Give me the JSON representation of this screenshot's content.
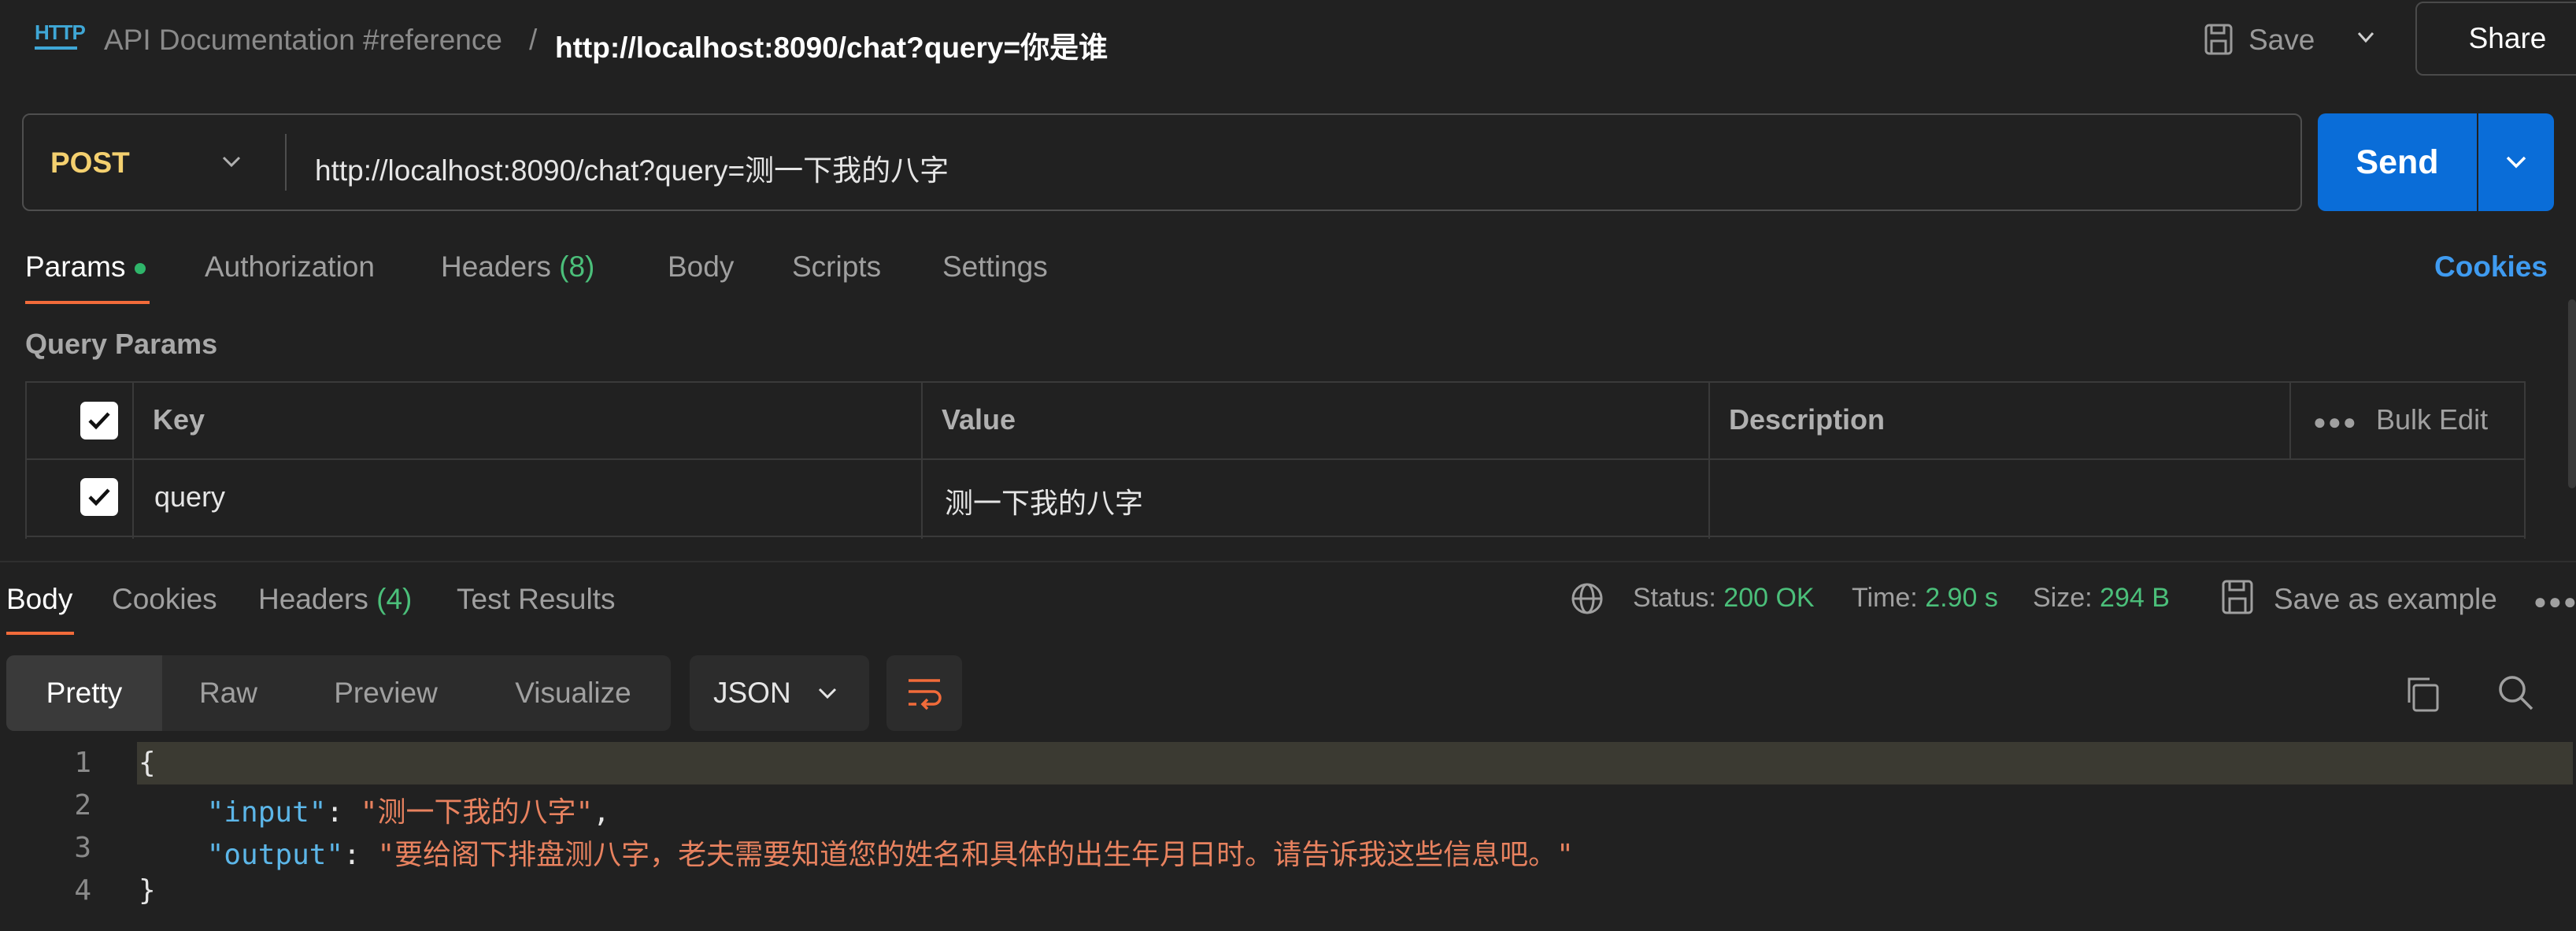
{
  "header": {
    "app_icon_text": "HTTP",
    "breadcrumb_parent": "API Documentation #reference",
    "breadcrumb_sep": "/",
    "title": "http://localhost:8090/chat?query=你是谁",
    "save_label": "Save",
    "share_label": "Share"
  },
  "request": {
    "method": "POST",
    "url": "http://localhost:8090/chat?query=测一下我的八字",
    "send_label": "Send"
  },
  "request_tabs": [
    {
      "label": "Params"
    },
    {
      "label": "Authorization"
    },
    {
      "label": "Headers",
      "count": "(8)"
    },
    {
      "label": "Body"
    },
    {
      "label": "Scripts"
    },
    {
      "label": "Settings"
    }
  ],
  "cookies_label": "Cookies",
  "query_params": {
    "title": "Query Params",
    "columns": {
      "key": "Key",
      "value": "Value",
      "description": "Description"
    },
    "bulk_edit_label": "Bulk Edit",
    "rows": [
      {
        "checked": true,
        "key": "query",
        "value": "测一下我的八字",
        "description": ""
      }
    ]
  },
  "response": {
    "tabs": [
      {
        "label": "Body"
      },
      {
        "label": "Cookies"
      },
      {
        "label": "Headers",
        "count": "(4)"
      },
      {
        "label": "Test Results"
      }
    ],
    "status_label": "Status:",
    "status_value": "200 OK",
    "time_label": "Time:",
    "time_value": "2.90 s",
    "size_label": "Size:",
    "size_value": "294 B",
    "save_example_label": "Save as example",
    "views": [
      "Pretty",
      "Raw",
      "Preview",
      "Visualize"
    ],
    "format": "JSON",
    "line_numbers": [
      "1",
      "2",
      "3",
      "4"
    ],
    "json": {
      "open": "{",
      "input_key": "\"input\"",
      "input_value": "\"测一下我的八字\"",
      "output_key": "\"output\"",
      "output_value": "\"要给阁下排盘测八字，老夫需要知道您的姓名和具体的出生年月日时。请告诉我这些信息吧。\"",
      "close": "}"
    }
  },
  "colors": {
    "accent_orange": "#f26b3a",
    "send_blue": "#0a6dd8",
    "method_yellow": "#f4d06f",
    "success_green": "#4bbf7a",
    "json_key": "#5cb6e8",
    "json_string": "#e8825f"
  }
}
